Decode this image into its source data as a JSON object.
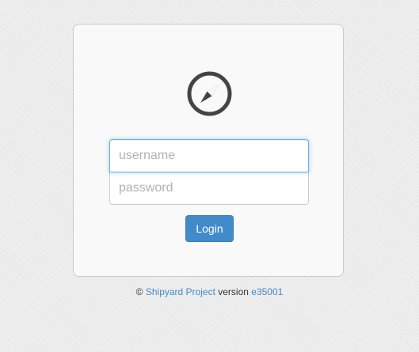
{
  "login": {
    "username_placeholder": "username",
    "password_placeholder": "password",
    "button_label": "Login",
    "logo_icon": "compass-icon"
  },
  "footer": {
    "copyright_symbol": "©",
    "project_link": "Shipyard Project",
    "version_text": "version",
    "version_link": "e35001"
  },
  "colors": {
    "accent": "#428bca",
    "focus_border": "#66afe9",
    "icon": "#444444"
  }
}
